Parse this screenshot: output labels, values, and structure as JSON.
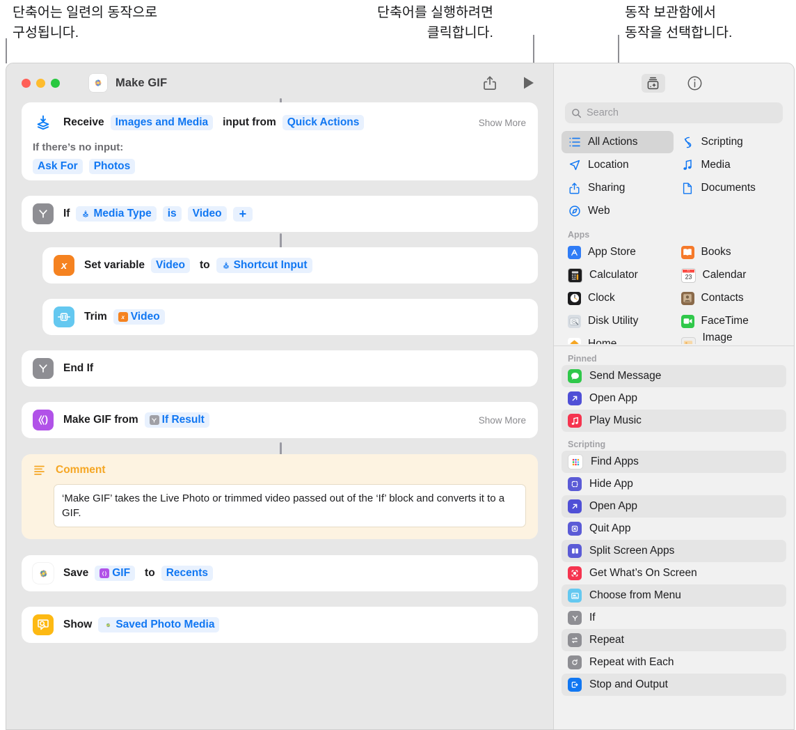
{
  "callouts": [
    {
      "id": "c1",
      "text": "단축어는 일련의 동작으로\n구성됩니다."
    },
    {
      "id": "c2",
      "text": "단축어를 실행하려면\n클릭합니다."
    },
    {
      "id": "c3",
      "text": "동작 보관함에서\n동작을 선택합니다."
    }
  ],
  "window": {
    "title": "Make GIF",
    "app_icon_name": "photos-app-icon",
    "traffic_lights": [
      "close-button",
      "minimize-button",
      "maximize-button"
    ],
    "toolbar": {
      "share_label": "share-icon",
      "run_label": "run-icon",
      "library_label": "action-library-icon",
      "info_label": "info-icon"
    }
  },
  "shortcut": {
    "actions": [
      {
        "icon": "receive-input-icon",
        "parts": [
          {
            "type": "text",
            "value": "Receive"
          },
          {
            "type": "token",
            "value": "Images and Media"
          },
          {
            "type": "text",
            "value": "input from"
          },
          {
            "type": "token",
            "value": "Quick Actions"
          }
        ],
        "show_more": "Show More",
        "sub_label": "If there’s no input:",
        "sub_tokens": [
          "Ask For",
          "Photos"
        ]
      },
      {
        "icon": "if-icon",
        "parts": [
          {
            "type": "text",
            "value": "If"
          },
          {
            "type": "token",
            "badge": "variable",
            "value": "Media Type"
          },
          {
            "type": "token",
            "value": "is"
          },
          {
            "type": "token",
            "value": "Video"
          },
          {
            "type": "token",
            "value": "+"
          }
        ]
      },
      {
        "icon": "set-variable-icon",
        "indent": true,
        "parts": [
          {
            "type": "text",
            "value": "Set variable"
          },
          {
            "type": "token",
            "value": "Video"
          },
          {
            "type": "text",
            "value": "to"
          },
          {
            "type": "token",
            "badge": "variable",
            "value": "Shortcut Input"
          }
        ]
      },
      {
        "icon": "trim-media-icon",
        "indent": true,
        "parts": [
          {
            "type": "text",
            "value": "Trim"
          },
          {
            "type": "token",
            "badge": "orange-x",
            "value": "Video"
          }
        ]
      },
      {
        "icon": "end-if-icon",
        "parts": [
          {
            "type": "text",
            "value": "End If"
          }
        ]
      },
      {
        "icon": "make-gif-icon",
        "parts": [
          {
            "type": "text",
            "value": "Make GIF from"
          },
          {
            "type": "token",
            "badge": "grey-y",
            "value": "If Result"
          }
        ],
        "show_more": "Show More"
      },
      {
        "icon": "comment-icon",
        "type": "comment",
        "title": "Comment",
        "body": "‘Make GIF’ takes the Live Photo or trimmed video passed out of the ‘If’ block and converts it to a GIF."
      },
      {
        "icon": "photos-icon",
        "parts": [
          {
            "type": "text",
            "value": "Save"
          },
          {
            "type": "token",
            "badge": "purple-gif",
            "value": "GIF"
          },
          {
            "type": "text",
            "value": "to"
          },
          {
            "type": "token",
            "value": "Recents"
          }
        ]
      },
      {
        "icon": "quick-look-icon",
        "parts": [
          {
            "type": "text",
            "value": "Show"
          },
          {
            "type": "token",
            "badge": "photos-dot",
            "value": "Saved Photo Media"
          }
        ]
      }
    ]
  },
  "library": {
    "search": {
      "placeholder": "Search",
      "value": ""
    },
    "categories": [
      {
        "label": "All Actions",
        "icon": "list-icon",
        "selected": true
      },
      {
        "label": "Scripting",
        "icon": "scripting-icon",
        "selected": false
      },
      {
        "label": "Location",
        "icon": "location-icon",
        "selected": false
      },
      {
        "label": "Media",
        "icon": "music-note-icon",
        "selected": false
      },
      {
        "label": "Sharing",
        "icon": "share-icon",
        "selected": false
      },
      {
        "label": "Documents",
        "icon": "document-icon",
        "selected": false
      },
      {
        "label": "Web",
        "icon": "compass-icon",
        "selected": false
      }
    ],
    "apps_section": {
      "title": "Apps",
      "items": [
        {
          "label": "App Store",
          "icon": "app-store-icon",
          "color": "#2f7cf6"
        },
        {
          "label": "Books",
          "icon": "books-icon",
          "color": "#f5792a"
        },
        {
          "label": "Calculator",
          "icon": "calculator-icon",
          "color": "#e8e8e8"
        },
        {
          "label": "Calendar",
          "icon": "calendar-icon",
          "color": "#ffffff"
        },
        {
          "label": "Clock",
          "icon": "clock-icon",
          "color": "#1c1c1e"
        },
        {
          "label": "Contacts",
          "icon": "contacts-icon",
          "color": "#8a6a4a"
        },
        {
          "label": "Disk Utility",
          "icon": "disk-utility-icon",
          "color": "#d8dde3"
        },
        {
          "label": "FaceTime",
          "icon": "facetime-icon",
          "color": "#2fc84a"
        },
        {
          "label": "Home",
          "icon": "home-icon",
          "color": "#f5a623"
        },
        {
          "label": "Image Playground",
          "icon": "image-playground-icon",
          "color": "#e8e8e8"
        }
      ]
    },
    "pinned_section": {
      "title": "Pinned",
      "items": [
        {
          "label": "Send Message",
          "icon": "messages-icon",
          "color": "#2fc84a"
        },
        {
          "label": "Open App",
          "icon": "open-app-icon",
          "color": "#4f4fd6"
        },
        {
          "label": "Play Music",
          "icon": "play-music-icon",
          "color": "#f5344f"
        }
      ]
    },
    "scripting_section": {
      "title": "Scripting",
      "items": [
        {
          "label": "Find Apps",
          "icon": "find-apps-icon",
          "color": "#ffffff"
        },
        {
          "label": "Hide App",
          "icon": "hide-app-icon",
          "color": "#5b5bd6"
        },
        {
          "label": "Open App",
          "icon": "open-app-icon",
          "color": "#4f4fd6"
        },
        {
          "label": "Quit App",
          "icon": "quit-app-icon",
          "color": "#5b5bd6"
        },
        {
          "label": "Split Screen Apps",
          "icon": "split-screen-icon",
          "color": "#5b5bd6"
        },
        {
          "label": "Get What’s On Screen",
          "icon": "get-screen-icon",
          "color": "#f5344f"
        },
        {
          "label": "Choose from Menu",
          "icon": "choose-menu-icon",
          "color": "#64c8f0"
        },
        {
          "label": "If",
          "icon": "if-icon",
          "color": "#8e8e93"
        },
        {
          "label": "Repeat",
          "icon": "repeat-icon",
          "color": "#8e8e93"
        },
        {
          "label": "Repeat with Each",
          "icon": "repeat-each-icon",
          "color": "#8e8e93"
        },
        {
          "label": "Stop and Output",
          "icon": "stop-output-icon",
          "color": "#1177f2"
        }
      ]
    }
  },
  "colors": {
    "accent_blue": "#1177f2",
    "token_bg": "#e8f1fe",
    "window_bg": "#e7e7e7",
    "panel_bg": "#f1f1f1",
    "comment_bg": "#fdf3e1",
    "comment_accent": "#f5a623"
  }
}
